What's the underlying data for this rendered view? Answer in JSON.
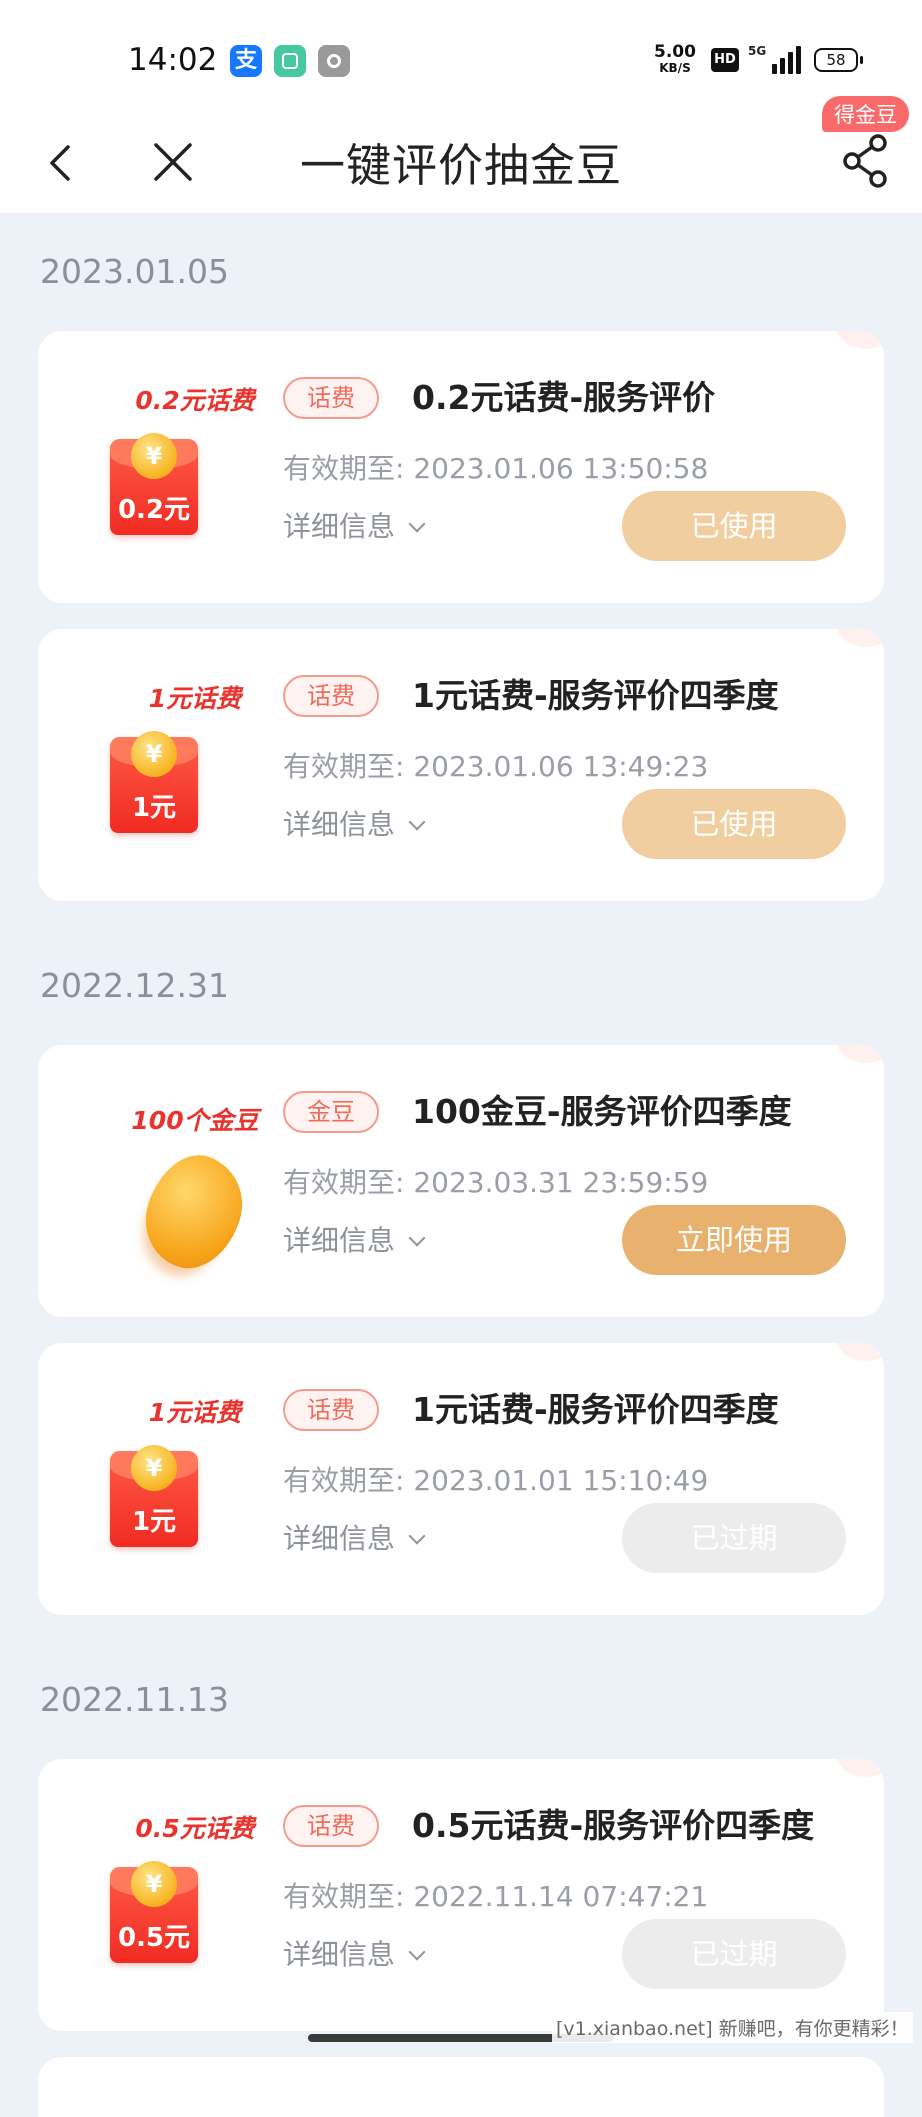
{
  "status_bar": {
    "time": "14:02",
    "alipay_glyph": "支",
    "net_speed": "5.00",
    "net_speed_unit": "KB/S",
    "hd": "HD",
    "network": "5G",
    "battery": "58"
  },
  "nav": {
    "title": "一键评价抽金豆",
    "share_badge": "得金豆"
  },
  "groups": [
    {
      "date": "2023.01.05",
      "items": [
        {
          "prize_label": "0.2元话费",
          "image": "red-envelope",
          "env_value": "0.2元",
          "tag": "话费",
          "title": "0.2元话费-服务评价",
          "expiry_label": "有效期至:",
          "expiry": "2023.01.06 13:50:58",
          "details": "详细信息",
          "button": "已使用",
          "status": "used"
        },
        {
          "prize_label": "1元话费",
          "image": "red-envelope",
          "env_value": "1元",
          "tag": "话费",
          "title": "1元话费-服务评价四季度",
          "expiry_label": "有效期至:",
          "expiry": "2023.01.06 13:49:23",
          "details": "详细信息",
          "button": "已使用",
          "status": "used"
        }
      ]
    },
    {
      "date": "2022.12.31",
      "items": [
        {
          "prize_label": "100个金豆",
          "image": "gold-bean",
          "env_value": "",
          "tag": "金豆",
          "title": "100金豆-服务评价四季度",
          "expiry_label": "有效期至:",
          "expiry": "2023.03.31 23:59:59",
          "details": "详细信息",
          "button": "立即使用",
          "status": "active"
        },
        {
          "prize_label": "1元话费",
          "image": "red-envelope",
          "env_value": "1元",
          "tag": "话费",
          "title": "1元话费-服务评价四季度",
          "expiry_label": "有效期至:",
          "expiry": "2023.01.01 15:10:49",
          "details": "详细信息",
          "button": "已过期",
          "status": "expired"
        }
      ]
    },
    {
      "date": "2022.11.13",
      "items": [
        {
          "prize_label": "0.5元话费",
          "image": "red-envelope",
          "env_value": "0.5元",
          "tag": "话费",
          "title": "0.5元话费-服务评价四季度",
          "expiry_label": "有效期至:",
          "expiry": "2022.11.14 07:47:21",
          "details": "详细信息",
          "button": "已过期",
          "status": "expired"
        }
      ]
    }
  ],
  "coin_glyph": "¥",
  "watermark": "[v1.xianbao.net] 新赚吧，有你更精彩！"
}
